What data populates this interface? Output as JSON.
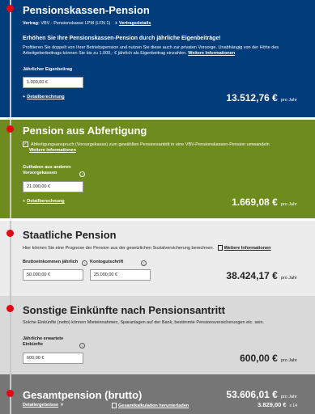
{
  "colors": {
    "blue": "#003b7a",
    "green": "#6e8b1e",
    "light_gray": "#ececec",
    "mid_gray": "#d9d9d9",
    "dark_gray": "#767676",
    "accent": "#e30613"
  },
  "s1": {
    "title": "Pensionskassen-Pension",
    "contract_label": "Vertrag:",
    "contract_value": " VBV - Pensionskasse LPM (LFN 1)",
    "contract_link": "Vertragsdetails",
    "promo_title": "Erhöhen Sie Ihre Pensionskassen-Pension durch jährliche Eigenbeiträge!",
    "promo_text_1": "Profitieren Sie doppelt von Ihrer Betriebspension und nutzen Sie diese auch zur privaten Vorsorge. Unabhängig von der Höhe des",
    "promo_text_2": "Arbeitgeberbeitrags können Sie bis zu 1.000,- € jährlich als Eigenbeitrag einzahlen.",
    "promo_link": "Weitere Informationen",
    "field_label": "Jährlicher Eigenbeitrag",
    "field_value": "1.000,00 €",
    "calc_link": "Detailberechnung",
    "amount": "13.512,76 €",
    "unit": "pro Jahr"
  },
  "s2": {
    "title": "Pension aus Abfertigung",
    "checkbox_text": "Abfertigungsanspruch (Vorsorgekasse) zum gewählten Pensionsantritt in eine VBV-Pensionskassen-Pension umwandeln",
    "checkbox_link": "Weitere Informationen",
    "field_label_1": "Guthaben aus anderen",
    "field_label_2": "Vorsorgekassen",
    "field_value": "21.000,00 €",
    "calc_link": "Detailberechnung",
    "amount": "1.669,08 €",
    "unit": "pro Jahr"
  },
  "s3": {
    "title": "Staatliche Pension",
    "text": "Hier können Sie eine Prognose der Pension aus der gesetzlichen Sozialversicherung berechnen.",
    "link": "Weitere Informationen",
    "label_income": "Bruttoeinkommen jährlich",
    "label_account": "Kontogutschrift",
    "income_value": "50.000,00 €",
    "account_value": "25.000,00 €",
    "amount": "38.424,17 €",
    "unit": "pro Jahr"
  },
  "s4": {
    "title": "Sonstige Einkünfte nach Pensionsantritt",
    "text": "Solche Einkünfte (netto) können Mieteinnahmen, Sparanlagen auf der Bank, bestimmte Pensionsversicherungen etc. sein.",
    "field_label_1": "Jährliche erwartete",
    "field_label_2": "Einkünfte",
    "field_value": "600,00 €",
    "amount": "600,00 €",
    "unit": "pro Jahr"
  },
  "s5": {
    "title": "Gesamtpension (brutto)",
    "amount": "53.606,01 €",
    "unit": "pro Jahr",
    "details_link": "Detailergebnisse",
    "download_link": "Gesamtkalkulation herunterladen",
    "monthly": "3.829,00 €",
    "monthly_unit": "x 14"
  }
}
